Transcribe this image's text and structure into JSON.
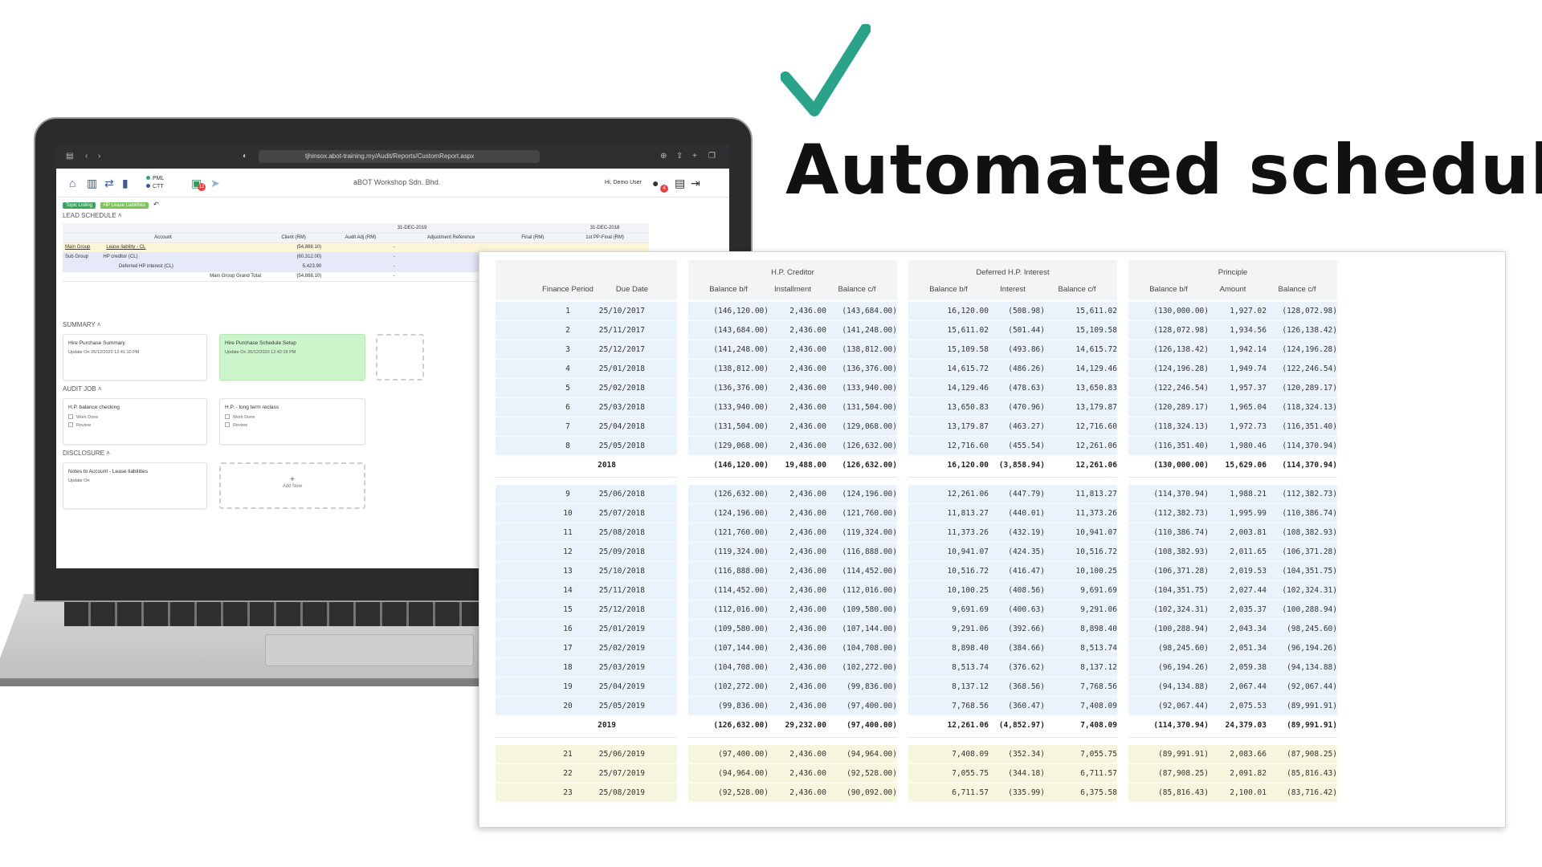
{
  "headline": "Automated schedules",
  "colors": {
    "check": "#2aa38a",
    "headline": "#111111",
    "row_blue": "#eaf3fb",
    "row_yellow": "#f6f5dd",
    "card_green": "#ccf5cc",
    "brand": "#3d5a96"
  },
  "browser": {
    "url": "tjhinsox.abot-training.my/Audit/Reports/CustomReport.aspx"
  },
  "app": {
    "company": "aBOT Workshop Sdn. Bhd.",
    "status": [
      "PML",
      "CTT"
    ],
    "notification_count": "12",
    "user_greeting": "Hi, Demo User",
    "user_badge": "4",
    "breadcrumb": [
      "Topic Listing",
      "HP Lease Liabilities"
    ],
    "icons": [
      "home-icon",
      "document-icon",
      "transfer-icon",
      "chart-icon",
      "clipboard-icon",
      "send-icon",
      "user-icon",
      "book-icon",
      "logout-icon"
    ]
  },
  "lead_schedule": {
    "title": "LEAD SCHEDULE",
    "date1": "31-DEC-2019",
    "date2": "31-DEC-2018",
    "headers": [
      "Account",
      "Client (RM)",
      "Audit Adj (RM)",
      "Adjustment Reference",
      "Final (RM)",
      "1st PP-Final (RM)"
    ],
    "rows": [
      {
        "group": "Main Group",
        "account": "Lease liability - CL",
        "client": "(54,888.10)",
        "adj": "-"
      },
      {
        "group": "Sub Group",
        "account": "HP creditor (CL)",
        "client": "(60,312.00)",
        "adj": "-"
      },
      {
        "group": "",
        "account": "Deferred HP interest (CL)",
        "client": "5,423.90",
        "adj": "-"
      }
    ],
    "grand_total_label": "Main Group Grand Total",
    "grand_total": "(54,888.10)",
    "grand_total_adj": "-"
  },
  "summary": {
    "title": "SUMMARY",
    "cards": [
      {
        "title": "Hire Purchase Summary",
        "sub": "Update On 26/12/2020 12:41:10 PM"
      },
      {
        "title": "Hire Purchase Schedule Setup",
        "sub": "Update On 26/12/2020 12:42:18 PM"
      }
    ]
  },
  "audit_job": {
    "title": "AUDIT JOB",
    "cards": [
      {
        "title": "H.P. balance checking",
        "items": [
          "Work Done",
          "Review"
        ]
      },
      {
        "title": "H.P. - long term reclass",
        "items": [
          "Work Done",
          "Review"
        ]
      }
    ]
  },
  "disclosure": {
    "title": "DISCLOSURE",
    "card": {
      "title": "Notes to Account - Lease liabilities",
      "sub": "Update On"
    },
    "add_new": "Add New",
    "add_icon": "+"
  },
  "schedule": {
    "groups": [
      "H.P. Creditor",
      "Deferred H.P. Interest",
      "Principle"
    ],
    "columns": [
      "Finance Period",
      "Due Date",
      "Balance b/f",
      "Installment",
      "Balance c/f",
      "Balance b/f",
      "Interest",
      "Balance c/f",
      "Balance b/f",
      "Amount",
      "Balance c/f"
    ],
    "blocks": [
      {
        "band": "blue",
        "rows": [
          [
            "1",
            "25/10/2017",
            "(146,120.00)",
            "2,436.00",
            "(143,684.00)",
            "16,120.00",
            "(508.98)",
            "15,611.02",
            "(130,000.00)",
            "1,927.02",
            "(128,072.98)"
          ],
          [
            "2",
            "25/11/2017",
            "(143,684.00)",
            "2,436.00",
            "(141,248.00)",
            "15,611.02",
            "(501.44)",
            "15,109.58",
            "(128,072.98)",
            "1,934.56",
            "(126,138.42)"
          ],
          [
            "3",
            "25/12/2017",
            "(141,248.00)",
            "2,436.00",
            "(138,812.00)",
            "15,109.58",
            "(493.86)",
            "14,615.72",
            "(126,138.42)",
            "1,942.14",
            "(124,196.28)"
          ],
          [
            "4",
            "25/01/2018",
            "(138,812.00)",
            "2,436.00",
            "(136,376.00)",
            "14,615.72",
            "(486.26)",
            "14,129.46",
            "(124,196.28)",
            "1,949.74",
            "(122,246.54)"
          ],
          [
            "5",
            "25/02/2018",
            "(136,376.00)",
            "2,436.00",
            "(133,940.00)",
            "14,129.46",
            "(478.63)",
            "13,650.83",
            "(122,246.54)",
            "1,957.37",
            "(120,289.17)"
          ],
          [
            "6",
            "25/03/2018",
            "(133,940.00)",
            "2,436.00",
            "(131,504.00)",
            "13,650.83",
            "(470.96)",
            "13,179.87",
            "(120,289.17)",
            "1,965.04",
            "(118,324.13)"
          ],
          [
            "7",
            "25/04/2018",
            "(131,504.00)",
            "2,436.00",
            "(129,068.00)",
            "13,179.87",
            "(463.27)",
            "12,716.60",
            "(118,324.13)",
            "1,972.73",
            "(116,351.40)"
          ],
          [
            "8",
            "25/05/2018",
            "(129,068.00)",
            "2,436.00",
            "(126,632.00)",
            "12,716.60",
            "(455.54)",
            "12,261.06",
            "(116,351.40)",
            "1,980.46",
            "(114,370.94)"
          ]
        ],
        "total": [
          "2018",
          "",
          "(146,120.00)",
          "19,488.00",
          "(126,632.00)",
          "16,120.00",
          "(3,858.94)",
          "12,261.06",
          "(130,000.00)",
          "15,629.06",
          "(114,370.94)"
        ]
      },
      {
        "band": "blue",
        "rows": [
          [
            "9",
            "25/06/2018",
            "(126,632.00)",
            "2,436.00",
            "(124,196.00)",
            "12,261.06",
            "(447.79)",
            "11,813.27",
            "(114,370.94)",
            "1,988.21",
            "(112,382.73)"
          ],
          [
            "10",
            "25/07/2018",
            "(124,196.00)",
            "2,436.00",
            "(121,760.00)",
            "11,813.27",
            "(440.01)",
            "11,373.26",
            "(112,382.73)",
            "1,995.99",
            "(110,386.74)"
          ],
          [
            "11",
            "25/08/2018",
            "(121,760.00)",
            "2,436.00",
            "(119,324.00)",
            "11,373.26",
            "(432.19)",
            "10,941.07",
            "(110,386.74)",
            "2,003.81",
            "(108,382.93)"
          ],
          [
            "12",
            "25/09/2018",
            "(119,324.00)",
            "2,436.00",
            "(116,888.00)",
            "10,941.07",
            "(424.35)",
            "10,516.72",
            "(108,382.93)",
            "2,011.65",
            "(106,371.28)"
          ],
          [
            "13",
            "25/10/2018",
            "(116,888.00)",
            "2,436.00",
            "(114,452.00)",
            "10,516.72",
            "(416.47)",
            "10,100.25",
            "(106,371.28)",
            "2,019.53",
            "(104,351.75)"
          ],
          [
            "14",
            "25/11/2018",
            "(114,452.00)",
            "2,436.00",
            "(112,016.00)",
            "10,100.25",
            "(408.56)",
            "9,691.69",
            "(104,351.75)",
            "2,027.44",
            "(102,324.31)"
          ],
          [
            "15",
            "25/12/2018",
            "(112,016.00)",
            "2,436.00",
            "(109,580.00)",
            "9,691.69",
            "(400.63)",
            "9,291.06",
            "(102,324.31)",
            "2,035.37",
            "(100,288.94)"
          ],
          [
            "16",
            "25/01/2019",
            "(109,580.00)",
            "2,436.00",
            "(107,144.00)",
            "9,291.06",
            "(392.66)",
            "8,898.40",
            "(100,288.94)",
            "2,043.34",
            "(98,245.60)"
          ],
          [
            "17",
            "25/02/2019",
            "(107,144.00)",
            "2,436.00",
            "(104,708.00)",
            "8,898.40",
            "(384.66)",
            "8,513.74",
            "(98,245.60)",
            "2,051.34",
            "(96,194.26)"
          ],
          [
            "18",
            "25/03/2019",
            "(104,708.00)",
            "2,436.00",
            "(102,272.00)",
            "8,513.74",
            "(376.62)",
            "8,137.12",
            "(96,194.26)",
            "2,059.38",
            "(94,134.88)"
          ],
          [
            "19",
            "25/04/2019",
            "(102,272.00)",
            "2,436.00",
            "(99,836.00)",
            "8,137.12",
            "(368.56)",
            "7,768.56",
            "(94,134.88)",
            "2,067.44",
            "(92,067.44)"
          ],
          [
            "20",
            "25/05/2019",
            "(99,836.00)",
            "2,436.00",
            "(97,400.00)",
            "7,768.56",
            "(360.47)",
            "7,408.09",
            "(92,067.44)",
            "2,075.53",
            "(89,991.91)"
          ]
        ],
        "total": [
          "2019",
          "",
          "(126,632.00)",
          "29,232.00",
          "(97,400.00)",
          "12,261.06",
          "(4,852.97)",
          "7,408.09",
          "(114,370.94)",
          "24,379.03",
          "(89,991.91)"
        ]
      },
      {
        "band": "yellow",
        "rows": [
          [
            "21",
            "25/06/2019",
            "(97,400.00)",
            "2,436.00",
            "(94,964.00)",
            "7,408.09",
            "(352.34)",
            "7,055.75",
            "(89,991.91)",
            "2,083.66",
            "(87,908.25)"
          ],
          [
            "22",
            "25/07/2019",
            "(94,964.00)",
            "2,436.00",
            "(92,528.00)",
            "7,055.75",
            "(344.18)",
            "6,711.57",
            "(87,908.25)",
            "2,091.82",
            "(85,816.43)"
          ],
          [
            "23",
            "25/08/2019",
            "(92,528.00)",
            "2,436.00",
            "(90,092.00)",
            "6,711.57",
            "(335.99)",
            "6,375.58",
            "(85,816.43)",
            "2,100.01",
            "(83,716.42)"
          ]
        ],
        "total": null
      }
    ]
  }
}
